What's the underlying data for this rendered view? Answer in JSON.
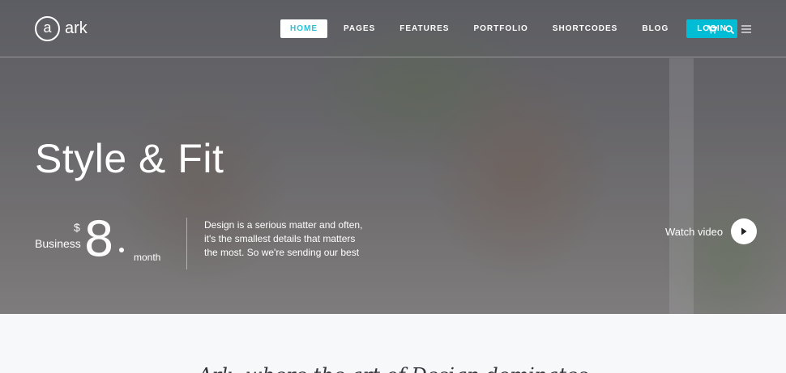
{
  "brand": {
    "logo_letter": "a",
    "name": "ark"
  },
  "nav": {
    "items": [
      {
        "label": "HOME",
        "active": true
      },
      {
        "label": "PAGES"
      },
      {
        "label": "FEATURES"
      },
      {
        "label": "PORTFOLIO"
      },
      {
        "label": "SHORTCODES"
      },
      {
        "label": "BLOG"
      }
    ],
    "login_label": "LOGIN",
    "icons": [
      "cart-icon",
      "search-icon",
      "menu-icon"
    ]
  },
  "hero": {
    "title": "Style & Fit",
    "price": {
      "label": "Business",
      "currency": "$",
      "amount": "8",
      "period": "month"
    },
    "description": [
      "Design is a serious matter and often,",
      "it's the smallest details that matters",
      "the most. So we're sending our best"
    ],
    "watch_label": "Watch video"
  },
  "section": {
    "heading": "Ark, where the art of Design dominates"
  },
  "colors": {
    "accent": "#00bcd4",
    "white": "#ffffff",
    "text_dark": "#34343c"
  }
}
